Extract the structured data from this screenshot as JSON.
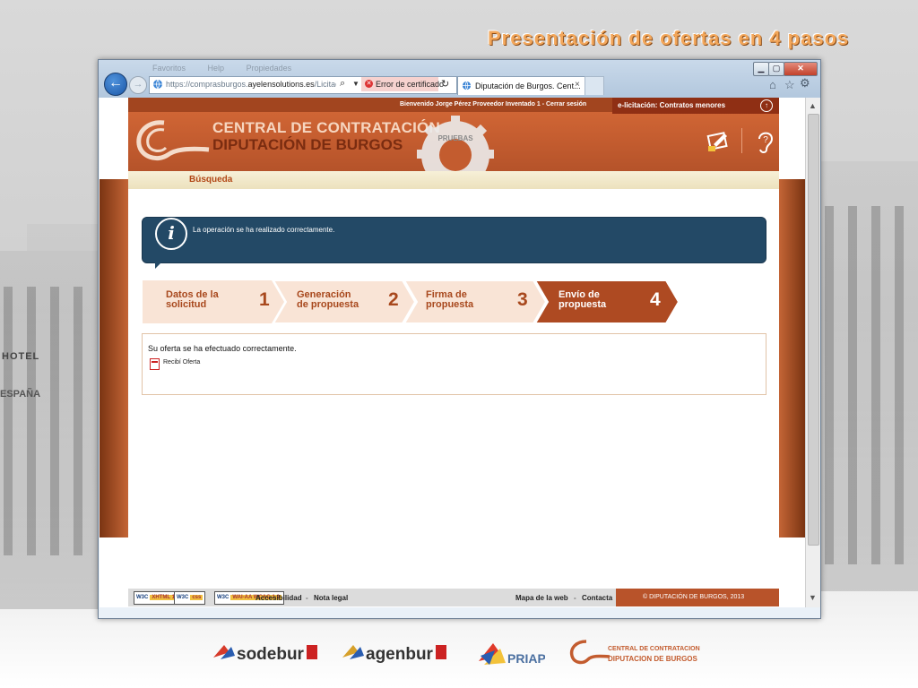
{
  "slide": {
    "title": "Presentación de ofertas en 4 pasos",
    "bg_text_hotel": "HOTEL",
    "bg_text_espana": "ESPAÑA"
  },
  "browser": {
    "ghost_menu": [
      "Favoritos",
      "Help",
      "Propiedades"
    ],
    "url_prefix": "https://comprasburgos.",
    "url_domain": "ayelensolutions.es",
    "url_suffix": "/Licitacion",
    "cert_error": "Error de certificado",
    "tab_title": "Diputación de Burgos. Cent...",
    "tab_close": "×"
  },
  "header": {
    "welcome": "Bienvenido Jorge Pérez Proveedor Inventado 1 - Cerrar sesión",
    "elicitacion": "e-licitación: Contratos menores",
    "brand_line1": "CENTRAL DE CONTRATACIÓN",
    "brand_line2": "DIPUTACIÓN DE BURGOS",
    "gear_text": "PRUEBAS"
  },
  "subnav": {
    "busqueda": "Búsqueda"
  },
  "info": {
    "message": "La operación se ha realizado correctamente."
  },
  "steps": [
    {
      "line1": "Datos de la",
      "line2": "solicitud",
      "num": "1"
    },
    {
      "line1": "Generación",
      "line2": "de propuesta",
      "num": "2"
    },
    {
      "line1": "Firma de",
      "line2": "propuesta",
      "num": "3"
    },
    {
      "line1": "Envío de",
      "line2": "propuesta",
      "num": "4"
    }
  ],
  "result": {
    "message": "Su oferta se ha efectuado correctamente.",
    "link": "Recibí Oferta"
  },
  "footer": {
    "badges": [
      {
        "a": "W3C",
        "b": "XHTML 1.0"
      },
      {
        "a": "W3C",
        "b": "css"
      },
      {
        "a": "W3C",
        "b": "WAI-AA WCAG 1.0"
      }
    ],
    "accesibilidad": "Accesibilidad",
    "nota_legal": "Nota legal",
    "mapa": "Mapa de la web",
    "contacta": "Contacta",
    "copyright": "© DIPUTACIÓN DE BURGOS, 2013"
  },
  "logos": {
    "sodebur": "sodebur",
    "agenbur": "agenbur",
    "priap": "PRIAP",
    "central_line1": "CENTRAL DE CONTRATACION",
    "central_line2": "DIPUTACION DE BURGOS"
  },
  "colors": {
    "accent": "#c35c2f",
    "info_bg": "#234966",
    "step_inactive": "#f9e4d6",
    "step_active": "#ae4a22"
  }
}
